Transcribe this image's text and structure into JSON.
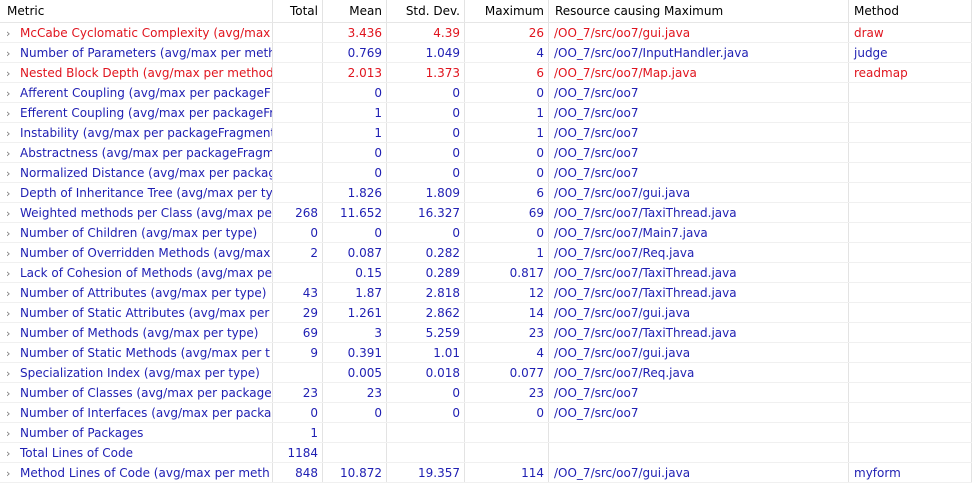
{
  "columns": {
    "metric": "Metric",
    "total": "Total",
    "mean": "Mean",
    "std": "Std. Dev.",
    "max": "Maximum",
    "resource": "Resource causing Maximum",
    "method": "Method"
  },
  "chevron": "›",
  "colors": {
    "normal_text": "#1f1fb3",
    "warning_text": "#e0141e"
  },
  "rows": [
    {
      "metric": "McCabe Cyclomatic Complexity (avg/max",
      "total": "",
      "mean": "3.436",
      "std": "4.39",
      "max": "26",
      "resource": "/OO_7/src/oo7/gui.java",
      "method": "draw",
      "warning": true
    },
    {
      "metric": "Number of Parameters (avg/max per meth",
      "total": "",
      "mean": "0.769",
      "std": "1.049",
      "max": "4",
      "resource": "/OO_7/src/oo7/InputHandler.java",
      "method": "judge",
      "warning": false
    },
    {
      "metric": "Nested Block Depth (avg/max per method",
      "total": "",
      "mean": "2.013",
      "std": "1.373",
      "max": "6",
      "resource": "/OO_7/src/oo7/Map.java",
      "method": "readmap",
      "warning": true
    },
    {
      "metric": "Afferent Coupling (avg/max per packageF",
      "total": "",
      "mean": "0",
      "std": "0",
      "max": "0",
      "resource": "/OO_7/src/oo7",
      "method": "",
      "warning": false
    },
    {
      "metric": "Efferent Coupling (avg/max per packageFr",
      "total": "",
      "mean": "1",
      "std": "0",
      "max": "1",
      "resource": "/OO_7/src/oo7",
      "method": "",
      "warning": false
    },
    {
      "metric": "Instability (avg/max per packageFragment",
      "total": "",
      "mean": "1",
      "std": "0",
      "max": "1",
      "resource": "/OO_7/src/oo7",
      "method": "",
      "warning": false
    },
    {
      "metric": "Abstractness (avg/max per packageFragm",
      "total": "",
      "mean": "0",
      "std": "0",
      "max": "0",
      "resource": "/OO_7/src/oo7",
      "method": "",
      "warning": false
    },
    {
      "metric": "Normalized Distance (avg/max per packag",
      "total": "",
      "mean": "0",
      "std": "0",
      "max": "0",
      "resource": "/OO_7/src/oo7",
      "method": "",
      "warning": false
    },
    {
      "metric": "Depth of Inheritance Tree (avg/max per ty",
      "total": "",
      "mean": "1.826",
      "std": "1.809",
      "max": "6",
      "resource": "/OO_7/src/oo7/gui.java",
      "method": "",
      "warning": false
    },
    {
      "metric": "Weighted methods per Class (avg/max pe",
      "total": "268",
      "mean": "11.652",
      "std": "16.327",
      "max": "69",
      "resource": "/OO_7/src/oo7/TaxiThread.java",
      "method": "",
      "warning": false
    },
    {
      "metric": "Number of Children (avg/max per type)",
      "total": "0",
      "mean": "0",
      "std": "0",
      "max": "0",
      "resource": "/OO_7/src/oo7/Main7.java",
      "method": "",
      "warning": false
    },
    {
      "metric": "Number of Overridden Methods (avg/max",
      "total": "2",
      "mean": "0.087",
      "std": "0.282",
      "max": "1",
      "resource": "/OO_7/src/oo7/Req.java",
      "method": "",
      "warning": false
    },
    {
      "metric": "Lack of Cohesion of Methods (avg/max pe",
      "total": "",
      "mean": "0.15",
      "std": "0.289",
      "max": "0.817",
      "resource": "/OO_7/src/oo7/TaxiThread.java",
      "method": "",
      "warning": false
    },
    {
      "metric": "Number of Attributes (avg/max per type)",
      "total": "43",
      "mean": "1.87",
      "std": "2.818",
      "max": "12",
      "resource": "/OO_7/src/oo7/TaxiThread.java",
      "method": "",
      "warning": false
    },
    {
      "metric": "Number of Static Attributes (avg/max per",
      "total": "29",
      "mean": "1.261",
      "std": "2.862",
      "max": "14",
      "resource": "/OO_7/src/oo7/gui.java",
      "method": "",
      "warning": false
    },
    {
      "metric": "Number of Methods (avg/max per type)",
      "total": "69",
      "mean": "3",
      "std": "5.259",
      "max": "23",
      "resource": "/OO_7/src/oo7/TaxiThread.java",
      "method": "",
      "warning": false
    },
    {
      "metric": "Number of Static Methods (avg/max per t",
      "total": "9",
      "mean": "0.391",
      "std": "1.01",
      "max": "4",
      "resource": "/OO_7/src/oo7/gui.java",
      "method": "",
      "warning": false
    },
    {
      "metric": "Specialization Index (avg/max per type)",
      "total": "",
      "mean": "0.005",
      "std": "0.018",
      "max": "0.077",
      "resource": "/OO_7/src/oo7/Req.java",
      "method": "",
      "warning": false
    },
    {
      "metric": "Number of Classes (avg/max per package",
      "total": "23",
      "mean": "23",
      "std": "0",
      "max": "23",
      "resource": "/OO_7/src/oo7",
      "method": "",
      "warning": false
    },
    {
      "metric": "Number of Interfaces (avg/max per packa",
      "total": "0",
      "mean": "0",
      "std": "0",
      "max": "0",
      "resource": "/OO_7/src/oo7",
      "method": "",
      "warning": false
    },
    {
      "metric": "Number of Packages",
      "total": "1",
      "mean": "",
      "std": "",
      "max": "",
      "resource": "",
      "method": "",
      "warning": false
    },
    {
      "metric": "Total Lines of Code",
      "total": "1184",
      "mean": "",
      "std": "",
      "max": "",
      "resource": "",
      "method": "",
      "warning": false
    },
    {
      "metric": "Method Lines of Code (avg/max per meth",
      "total": "848",
      "mean": "10.872",
      "std": "19.357",
      "max": "114",
      "resource": "/OO_7/src/oo7/gui.java",
      "method": "myform",
      "warning": false
    }
  ]
}
